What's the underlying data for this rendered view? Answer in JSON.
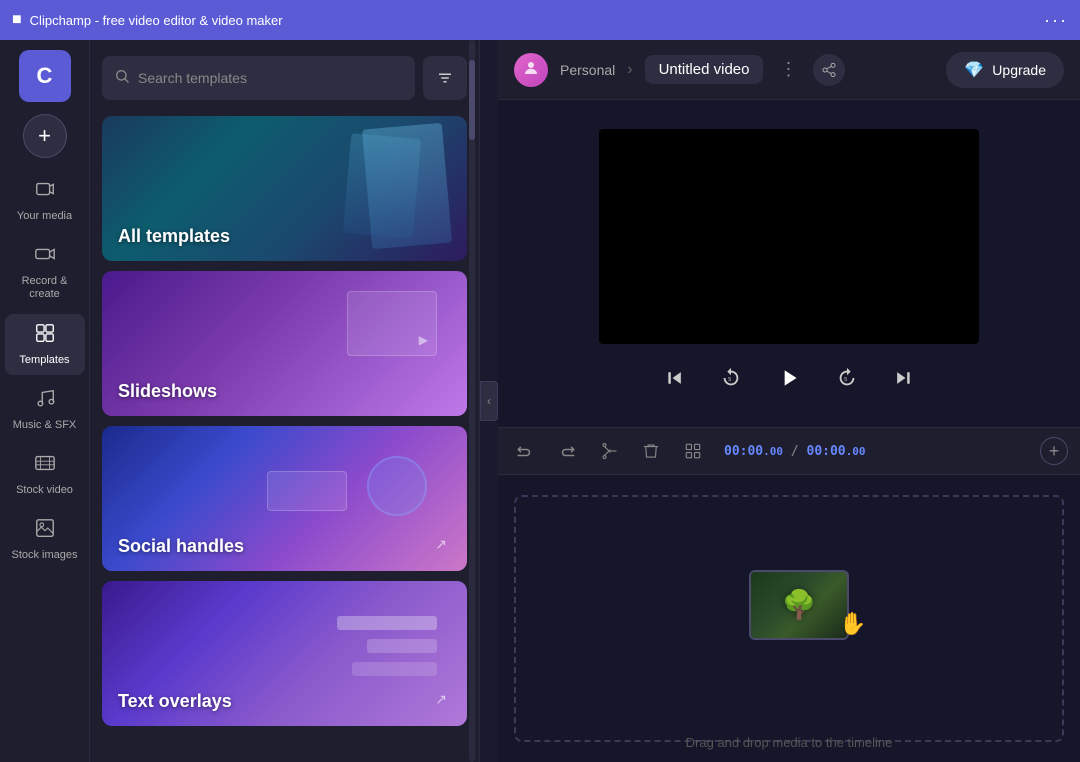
{
  "titlebar": {
    "title": "Clipchamp - free video editor & video maker",
    "dots": "···"
  },
  "sidebar": {
    "logo_letter": "C",
    "add_btn": "+",
    "items": [
      {
        "id": "your-media",
        "label": "Your media",
        "icon": "🗂"
      },
      {
        "id": "record-create",
        "label": "Record &\ncreate",
        "icon": "📹"
      },
      {
        "id": "templates",
        "label": "Templates",
        "icon": "⊞",
        "active": true
      },
      {
        "id": "music-sfx",
        "label": "Music & SFX",
        "icon": "🎵"
      },
      {
        "id": "stock-video",
        "label": "Stock video",
        "icon": "🎬"
      },
      {
        "id": "stock-images",
        "label": "Stock images",
        "icon": "🖼"
      }
    ]
  },
  "panel": {
    "search_placeholder": "Search templates",
    "filter_icon": "≡",
    "templates": [
      {
        "id": "all-templates",
        "label": "All templates",
        "type": "all"
      },
      {
        "id": "slideshows",
        "label": "Slideshows",
        "type": "slideshows"
      },
      {
        "id": "social-handles",
        "label": "Social handles",
        "type": "social"
      },
      {
        "id": "text-overlays",
        "label": "Text overlays",
        "type": "text-overlays"
      }
    ]
  },
  "header": {
    "personal_label": "Personal",
    "project_name": "Untitled video",
    "dots": "⋮",
    "upgrade_label": "Upgrade"
  },
  "timeline": {
    "undo_icon": "↩",
    "redo_icon": "↪",
    "scissors_icon": "✂",
    "delete_icon": "🗑",
    "clip_icon": "⧉",
    "time_current": "00:00",
    "time_current_frames": ".00",
    "time_separator": "/",
    "time_total": "00:00",
    "time_total_frames": ".00",
    "add_icon": "+",
    "drag_hint": "Drag and drop media to the timeline"
  },
  "playback": {
    "skip_back_icon": "⏮",
    "rewind_5_icon": "↺",
    "play_icon": "▶",
    "forward_5_icon": "↻",
    "skip_forward_icon": "⏭"
  },
  "colors": {
    "accent": "#5b5bd6",
    "time_color": "#6688ff",
    "bg_dark": "#16162a",
    "bg_panel": "#1e1e2e"
  }
}
